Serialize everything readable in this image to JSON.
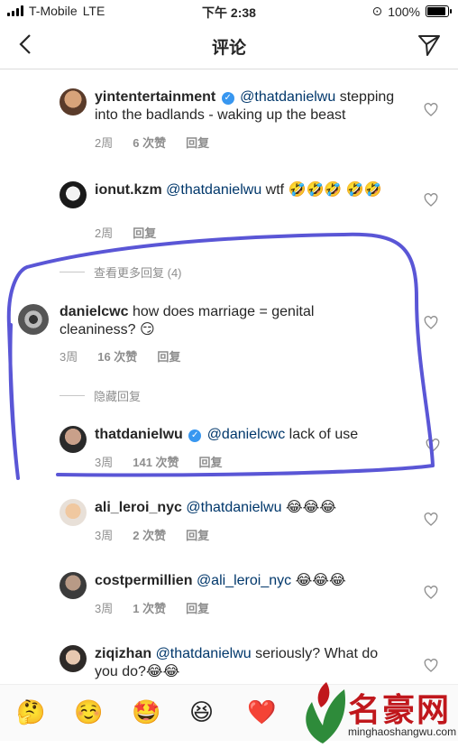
{
  "status": {
    "carrier": "T-Mobile",
    "network": "LTE",
    "time": "下午 2:38",
    "battery": "100%"
  },
  "nav": {
    "title": "评论"
  },
  "comments": [
    {
      "username": "yintentertainment",
      "verified": true,
      "mention": "@thatdanielwu",
      "text": " stepping into the badlands - waking up the beast",
      "age": "2周",
      "likes": "6 次赞",
      "reply": "回复"
    },
    {
      "username": "ionut.kzm",
      "verified": false,
      "mention": "@thatdanielwu",
      "text": " wtf 🤣🤣🤣 🤣🤣",
      "age": "2周",
      "likes": "",
      "reply": "回复"
    },
    {
      "username": "danielcwc",
      "verified": false,
      "mention": "",
      "text": "how does marriage = genital cleaniness? 😏",
      "age": "3周",
      "likes": "16 次赞",
      "reply": "回复"
    },
    {
      "username": "thatdanielwu",
      "verified": true,
      "mention": "@danielcwc",
      "text": " lack of use",
      "age": "3周",
      "likes": "141 次赞",
      "reply": "回复"
    },
    {
      "username": "ali_leroi_nyc",
      "verified": false,
      "mention": "@thatdanielwu",
      "text": " 😂😂😂",
      "age": "3周",
      "likes": "2 次赞",
      "reply": "回复"
    },
    {
      "username": "costpermillien",
      "verified": false,
      "mention": "@ali_leroi_nyc",
      "text": " 😂😂😂",
      "age": "3周",
      "likes": "1 次赞",
      "reply": "回复"
    },
    {
      "username": "ziqizhan",
      "verified": false,
      "mention": "@thatdanielwu",
      "text": " seriously? What do you do?😂😂",
      "age": "",
      "likes": "",
      "reply": ""
    }
  ],
  "threads": {
    "view_more": "查看更多回复 (4)",
    "hide": "隐藏回复"
  },
  "emojis": [
    "🤔",
    "☺️",
    "🤩",
    "😆",
    "❤️"
  ],
  "watermark": {
    "main": "名豪网",
    "sub": "minghaoshangwu.com"
  },
  "colors": {
    "annotation": "#5a56d6",
    "verified": "#3897f0",
    "watermark": "#c0171c"
  }
}
